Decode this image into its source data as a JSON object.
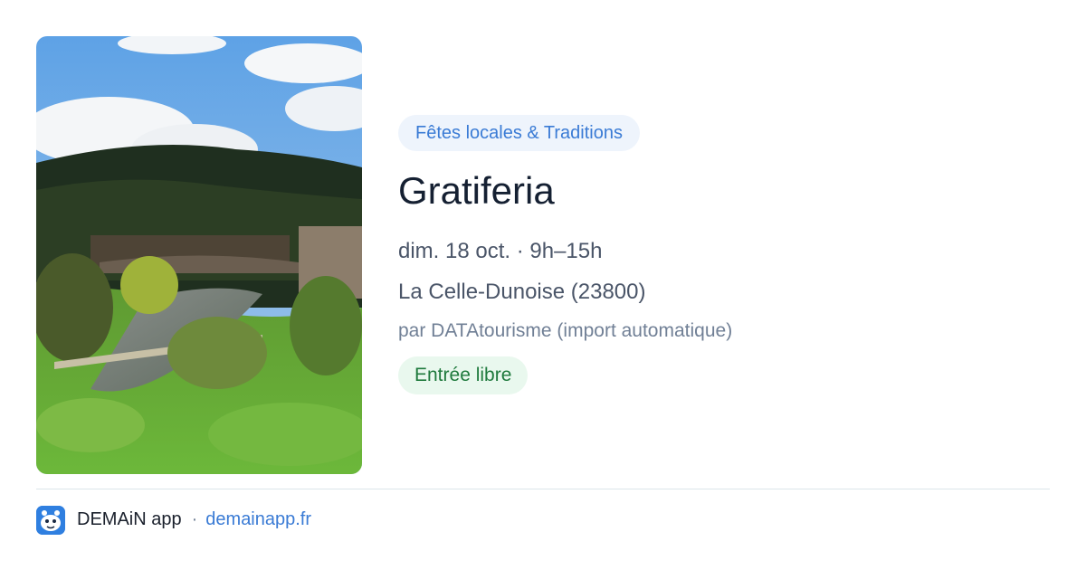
{
  "event": {
    "image_alt": "Rural landscape with river, stone bridge and wooded hill",
    "category": "Fêtes locales & Traditions",
    "title": "Gratiferia",
    "datetime": "dim. 18 oct. · 9h–15h",
    "location": "La Celle-Dunoise (23800)",
    "source": "par DATAtourisme (import automatique)",
    "price": "Entrée libre"
  },
  "footer": {
    "app_icon": "demain-app-logo-icon",
    "app_name": "DEMAiN app",
    "separator": "·",
    "site": "demainapp.fr"
  },
  "colors": {
    "accent": "#3a7bd5",
    "category_bg": "#eef4fc",
    "price_bg": "#e9f8ee",
    "price_text": "#1f7a3d",
    "title_text": "#152032"
  }
}
